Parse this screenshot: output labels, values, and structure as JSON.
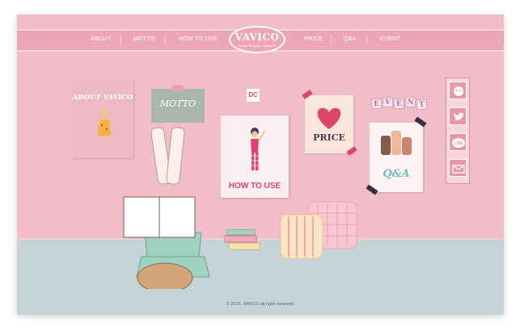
{
  "nav": {
    "items": [
      "ABOUT",
      "MOTTO",
      "HOW TO USE",
      "PRICE",
      "Q&A",
      "EVENT"
    ]
  },
  "logo": {
    "title": "VAVICO",
    "subtitle": "Korea Beauty Cosmetic"
  },
  "posters": {
    "about": "ABOUT VAVICO",
    "motto": "MOTTO",
    "dc": "DC",
    "how_to_use": "HOW TO USE",
    "price": "PRICE",
    "qa": "Q&A",
    "event": [
      "E",
      "V",
      "E",
      "N",
      "T"
    ]
  },
  "social": {
    "items": [
      "kakao-icon",
      "twitter-icon",
      "line-icon",
      "mail-icon"
    ],
    "line_label": "LINE"
  },
  "footer": {
    "copyright": "© 2019, VAVICO all right reserved."
  },
  "colors": {
    "wall": "#f2bdc8",
    "nav": "#eca6b7",
    "floor": "#c5d3d6",
    "accent": "#e0446a"
  }
}
